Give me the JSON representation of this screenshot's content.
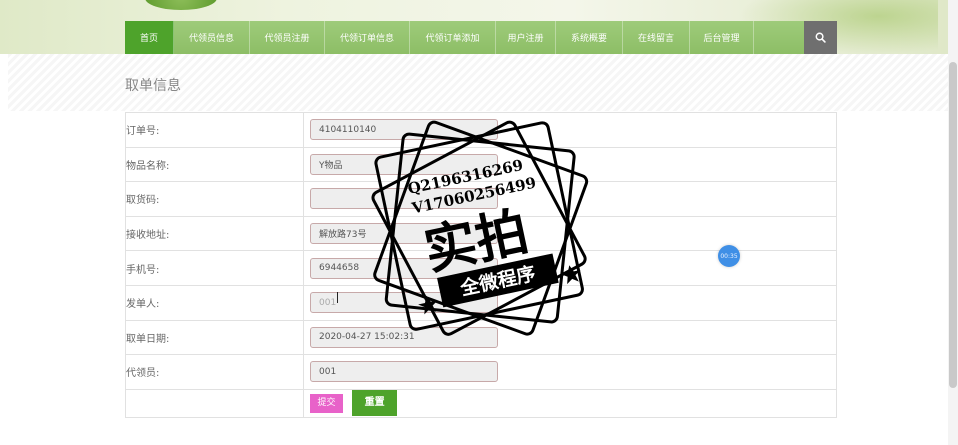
{
  "nav": {
    "items": [
      {
        "label": "首页",
        "active": true
      },
      {
        "label": "代领员信息"
      },
      {
        "label": "代领员注册"
      },
      {
        "label": "代领订单信息"
      },
      {
        "label": "代领订单添加"
      },
      {
        "label": "用户注册"
      },
      {
        "label": "系统概要"
      },
      {
        "label": "在线留言"
      },
      {
        "label": "后台管理"
      }
    ],
    "search_icon": "search-icon"
  },
  "page": {
    "title": "取单信息"
  },
  "form": {
    "fields": [
      {
        "label": "订单号:",
        "value": "4104110140"
      },
      {
        "label": "物品名称:",
        "value": "Y物品"
      },
      {
        "label": "取货码:",
        "value": ""
      },
      {
        "label": "接收地址:",
        "value": "解放路73号"
      },
      {
        "label": "手机号:",
        "value": "6944658"
      },
      {
        "label": "发单人:",
        "value": "001"
      },
      {
        "label": "取单日期:",
        "value": "2020-04-27 15:02:31"
      },
      {
        "label": "代领员:",
        "value": "001"
      }
    ],
    "submit_label": "提交",
    "reset_label": "重置"
  },
  "timer": {
    "text": "00:35"
  },
  "watermark": {
    "line1": "Q2196316269",
    "line2": "V17060256499",
    "big": "实拍",
    "ribbon": "全微程序"
  },
  "colors": {
    "nav_bg": "#8dbe66",
    "nav_active": "#4ea32b",
    "submit": "#e862c9",
    "reset": "#4ea32b",
    "search_bg": "#6f6f6f"
  }
}
